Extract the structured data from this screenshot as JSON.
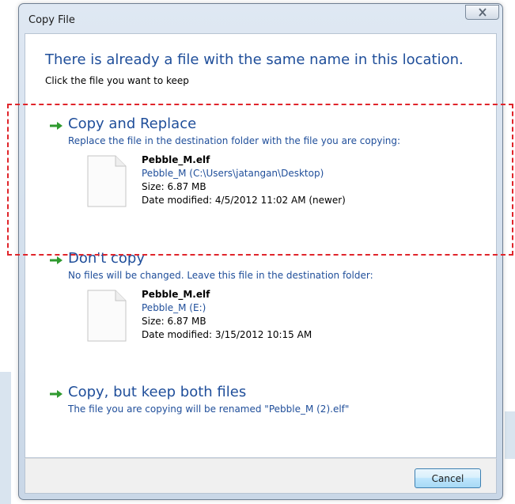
{
  "window": {
    "title": "Copy File",
    "close_glyph": "✕"
  },
  "heading": "There is already a file with the same name in this location.",
  "subheading": "Click the file you want to keep",
  "options": [
    {
      "title": "Copy and Replace",
      "description": "Replace the file in the destination folder with the file you are copying:",
      "file": {
        "name": "Pebble_M.elf",
        "location": "Pebble_M (C:\\Users\\jatangan\\Desktop)",
        "size": "Size: 6.87 MB",
        "date": "Date modified: 4/5/2012 11:02 AM (newer)"
      }
    },
    {
      "title": "Don't copy",
      "description": "No files will be changed. Leave this file in the destination folder:",
      "file": {
        "name": "Pebble_M.elf",
        "location": "Pebble_M (E:)",
        "size": "Size: 6.87 MB",
        "date": "Date modified: 3/15/2012 10:15 AM"
      }
    },
    {
      "title": "Copy, but keep both files",
      "description": "The file you are copying will be renamed \"Pebble_M (2).elf\""
    }
  ],
  "footer": {
    "cancel_label": "Cancel"
  },
  "colors": {
    "link_blue": "#1f4e9a",
    "arrow_green": "#2f9a2f",
    "annotation_red": "#e0252b"
  },
  "icons": {
    "option_arrow": "green-arrow-icon",
    "file": "document-icon",
    "close": "close-icon"
  }
}
